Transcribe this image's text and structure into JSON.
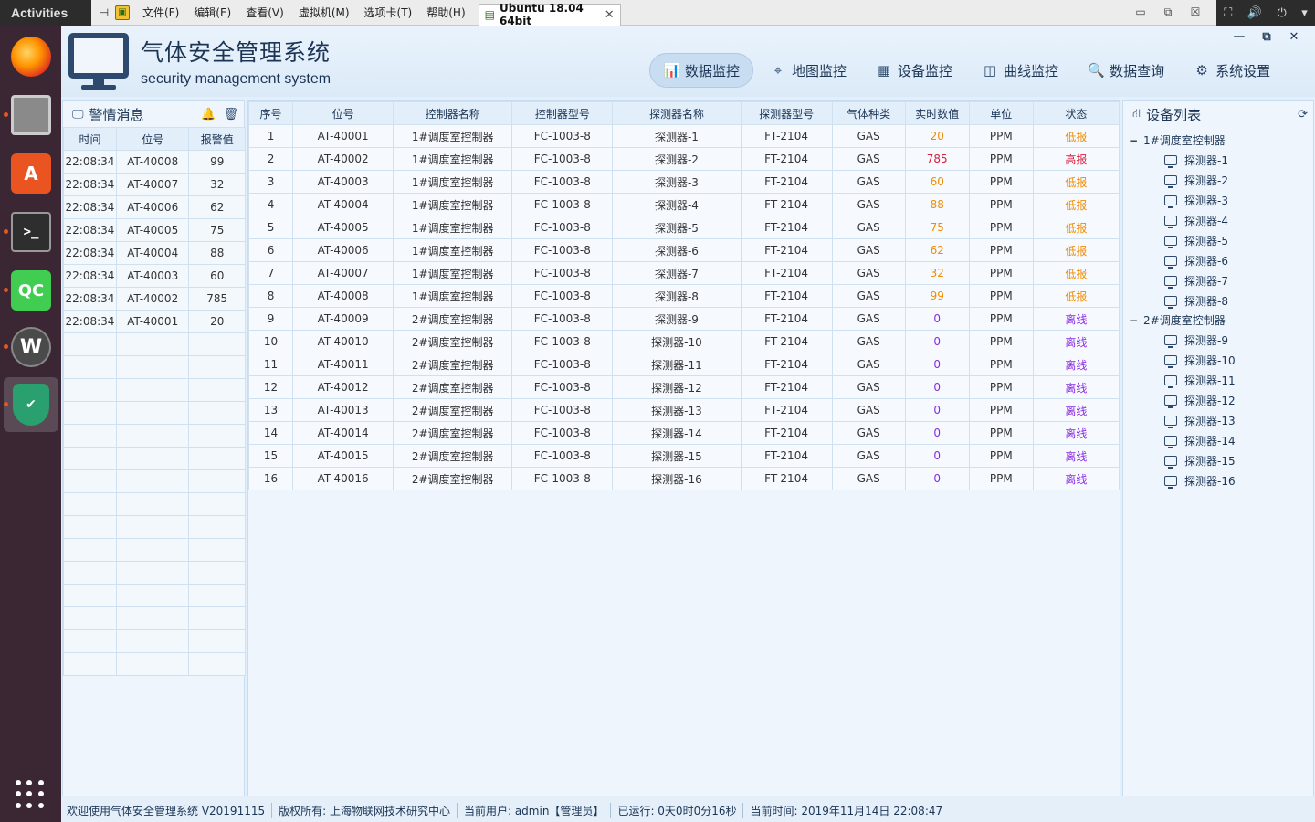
{
  "os": {
    "activities_label": "Activities",
    "vm_tab_title": "Ubuntu 18.04 64bit",
    "vm_menu": [
      "文件(F)",
      "编辑(E)",
      "查看(V)",
      "虚拟机(M)",
      "选项卡(T)",
      "帮助(H)"
    ]
  },
  "app": {
    "title": "气体安全管理系统",
    "subtitle": "security management system",
    "colors": {
      "low": "#f08c00",
      "high": "#d81e3c",
      "offline": "#8a2be2",
      "nav_active": "#c9ddf2"
    },
    "nav": [
      {
        "label": "数据监控",
        "icon": "bar-chart-icon",
        "glyph": "📊",
        "active": true
      },
      {
        "label": "地图监控",
        "icon": "map-marker-icon",
        "glyph": "⌖",
        "active": false
      },
      {
        "label": "设备监控",
        "icon": "grid-icon",
        "glyph": "▦",
        "active": false
      },
      {
        "label": "曲线监控",
        "icon": "monitor-curve-icon",
        "glyph": "◫",
        "active": false
      },
      {
        "label": "数据查询",
        "icon": "search-icon",
        "glyph": "🔍",
        "active": false
      },
      {
        "label": "系统设置",
        "icon": "gear-icon",
        "glyph": "⚙",
        "active": false
      }
    ]
  },
  "alarm_panel": {
    "title": "警情消息",
    "headers": [
      "时间",
      "位号",
      "报警值"
    ],
    "rows": [
      [
        "22:08:34",
        "AT-40008",
        "99"
      ],
      [
        "22:08:34",
        "AT-40007",
        "32"
      ],
      [
        "22:08:34",
        "AT-40006",
        "62"
      ],
      [
        "22:08:34",
        "AT-40005",
        "75"
      ],
      [
        "22:08:34",
        "AT-40004",
        "88"
      ],
      [
        "22:08:34",
        "AT-40003",
        "60"
      ],
      [
        "22:08:34",
        "AT-40002",
        "785"
      ],
      [
        "22:08:34",
        "AT-40001",
        "20"
      ]
    ],
    "empty_rows": 15
  },
  "data_table": {
    "headers": [
      "序号",
      "位号",
      "控制器名称",
      "控制器型号",
      "探测器名称",
      "探测器型号",
      "气体种类",
      "实时数值",
      "单位",
      "状态"
    ],
    "rows": [
      [
        "1",
        "AT-40001",
        "1#调度室控制器",
        "FC-1003-8",
        "探测器-1",
        "FT-2104",
        "GAS",
        "20",
        "PPM",
        "低报",
        "low"
      ],
      [
        "2",
        "AT-40002",
        "1#调度室控制器",
        "FC-1003-8",
        "探测器-2",
        "FT-2104",
        "GAS",
        "785",
        "PPM",
        "高报",
        "high"
      ],
      [
        "3",
        "AT-40003",
        "1#调度室控制器",
        "FC-1003-8",
        "探测器-3",
        "FT-2104",
        "GAS",
        "60",
        "PPM",
        "低报",
        "low"
      ],
      [
        "4",
        "AT-40004",
        "1#调度室控制器",
        "FC-1003-8",
        "探测器-4",
        "FT-2104",
        "GAS",
        "88",
        "PPM",
        "低报",
        "low"
      ],
      [
        "5",
        "AT-40005",
        "1#调度室控制器",
        "FC-1003-8",
        "探测器-5",
        "FT-2104",
        "GAS",
        "75",
        "PPM",
        "低报",
        "low"
      ],
      [
        "6",
        "AT-40006",
        "1#调度室控制器",
        "FC-1003-8",
        "探测器-6",
        "FT-2104",
        "GAS",
        "62",
        "PPM",
        "低报",
        "low"
      ],
      [
        "7",
        "AT-40007",
        "1#调度室控制器",
        "FC-1003-8",
        "探测器-7",
        "FT-2104",
        "GAS",
        "32",
        "PPM",
        "低报",
        "low"
      ],
      [
        "8",
        "AT-40008",
        "1#调度室控制器",
        "FC-1003-8",
        "探测器-8",
        "FT-2104",
        "GAS",
        "99",
        "PPM",
        "低报",
        "low"
      ],
      [
        "9",
        "AT-40009",
        "2#调度室控制器",
        "FC-1003-8",
        "探测器-9",
        "FT-2104",
        "GAS",
        "0",
        "PPM",
        "离线",
        "offline"
      ],
      [
        "10",
        "AT-40010",
        "2#调度室控制器",
        "FC-1003-8",
        "探测器-10",
        "FT-2104",
        "GAS",
        "0",
        "PPM",
        "离线",
        "offline"
      ],
      [
        "11",
        "AT-40011",
        "2#调度室控制器",
        "FC-1003-8",
        "探测器-11",
        "FT-2104",
        "GAS",
        "0",
        "PPM",
        "离线",
        "offline"
      ],
      [
        "12",
        "AT-40012",
        "2#调度室控制器",
        "FC-1003-8",
        "探测器-12",
        "FT-2104",
        "GAS",
        "0",
        "PPM",
        "离线",
        "offline"
      ],
      [
        "13",
        "AT-40013",
        "2#调度室控制器",
        "FC-1003-8",
        "探测器-13",
        "FT-2104",
        "GAS",
        "0",
        "PPM",
        "离线",
        "offline"
      ],
      [
        "14",
        "AT-40014",
        "2#调度室控制器",
        "FC-1003-8",
        "探测器-14",
        "FT-2104",
        "GAS",
        "0",
        "PPM",
        "离线",
        "offline"
      ],
      [
        "15",
        "AT-40015",
        "2#调度室控制器",
        "FC-1003-8",
        "探测器-15",
        "FT-2104",
        "GAS",
        "0",
        "PPM",
        "离线",
        "offline"
      ],
      [
        "16",
        "AT-40016",
        "2#调度室控制器",
        "FC-1003-8",
        "探测器-16",
        "FT-2104",
        "GAS",
        "0",
        "PPM",
        "离线",
        "offline"
      ]
    ]
  },
  "device_list": {
    "title": "设备列表",
    "groups": [
      {
        "name": "1#调度室控制器",
        "items": [
          "探测器-1",
          "探测器-2",
          "探测器-3",
          "探测器-4",
          "探测器-5",
          "探测器-6",
          "探测器-7",
          "探测器-8"
        ]
      },
      {
        "name": "2#调度室控制器",
        "items": [
          "探测器-9",
          "探测器-10",
          "探测器-11",
          "探测器-12",
          "探测器-13",
          "探测器-14",
          "探测器-15",
          "探测器-16"
        ]
      }
    ]
  },
  "statusbar": {
    "welcome": "欢迎使用气体安全管理系统 V20191115",
    "copyright": "版权所有: 上海物联网技术研究中心",
    "user": "当前用户: admin【管理员】",
    "runtime": "已运行: 0天0时0分16秒",
    "time": "当前时间: 2019年11月14日 22:08:47"
  }
}
